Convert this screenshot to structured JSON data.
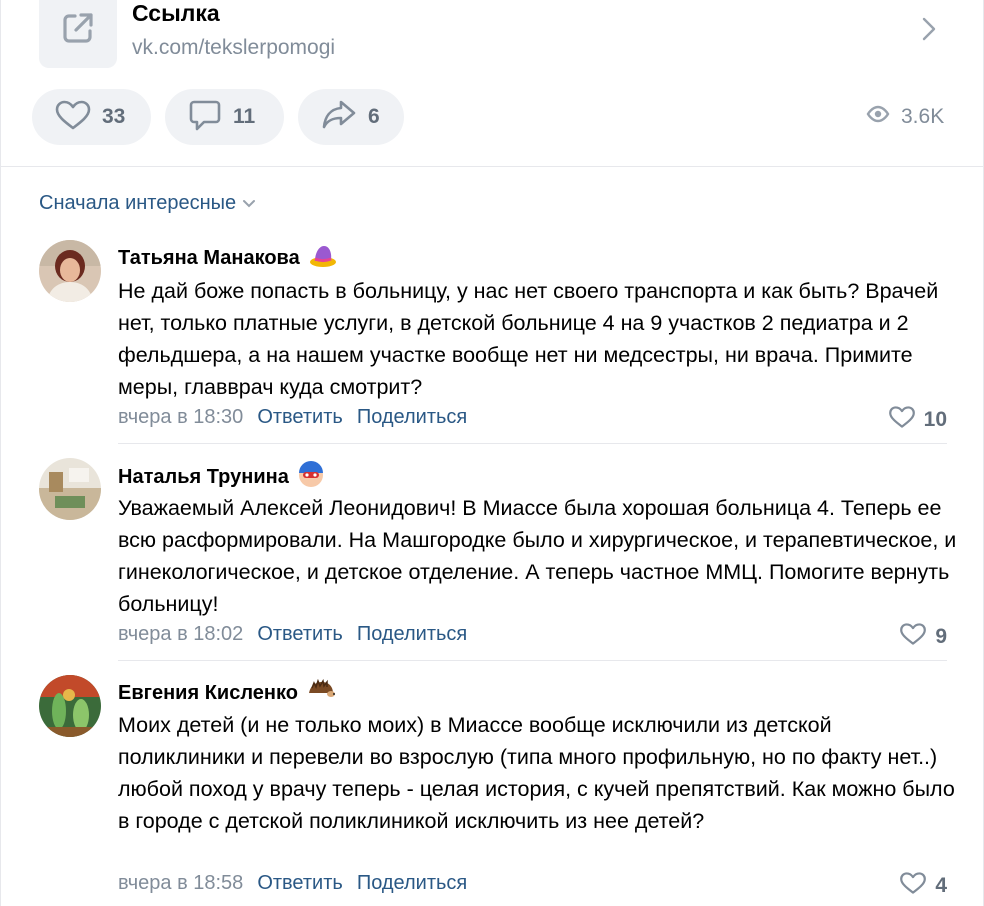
{
  "link": {
    "title": "Ссылка",
    "url": "vk.com/tekslerpomogi"
  },
  "actions": {
    "likes": "33",
    "comments": "11",
    "shares": "6",
    "views": "3.6K"
  },
  "sort_label": "Сначала интересные",
  "comments": [
    {
      "author": "Татьяна Манакова",
      "text": "Не дай боже попасть в больницу, у нас нет своего транспорта и как быть? Врачей нет, только платные услуги, в детской больнице 4 на 9 участков 2 педиатра и 2 фельдшера, а на нашем участке вообще нет ни медсестры, ни врача. Примите меры, главврач куда смотрит?",
      "time": "вчера в 18:30",
      "reply": "Ответить",
      "share": "Поделиться",
      "likes": "10"
    },
    {
      "author": "Наталья Трунина",
      "text": "Уважаемый Алексей Леонидович! В Миассе была хорошая больница 4. Теперь ее всю расформировали. На Машгородке было и хирургическое, и терапевтическое, и гинекологическое, и детское отделение. А теперь частное ММЦ. Помогите вернуть больницу!",
      "time": "вчера в 18:02",
      "reply": "Ответить",
      "share": "Поделиться",
      "likes": "9"
    },
    {
      "author": "Евгения Кисленко",
      "text": "Моих детей (и не только моих) в Миассе вообще исключили из детской поликлиники и перевели во взрослую (типа много профильную, но по факту нет..) любой поход у врачу теперь - целая история, с кучей препятствий. Как можно было в городе с детской поликлиникой исключить из нее детей?",
      "time": "вчера в 18:58",
      "reply": "Ответить",
      "share": "Поделиться",
      "likes": "4"
    }
  ],
  "colors": {
    "link_blue": "#2a5885",
    "muted": "#818c99",
    "pill_bg": "#f0f2f5",
    "icon": "#99a2ad"
  }
}
